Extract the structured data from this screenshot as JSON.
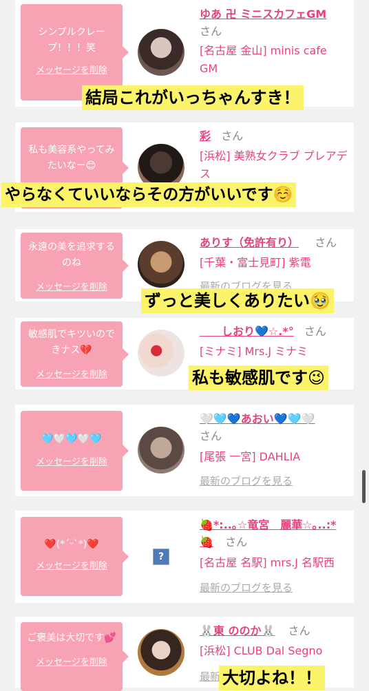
{
  "delete_label": "メッセージを削除",
  "blog_label": "最新のブログを見る",
  "san": "さん",
  "cards": [
    {
      "message": "シンプルクレープ！！！笑",
      "name": "ゆあ 卍 ミニスカフェGM",
      "shop": "[名古屋 金山] minis cafe GM"
    },
    {
      "message": "私も美容系やってみたいなー😊",
      "name": "彩",
      "shop": "[浜松] 美熟女クラブ プレアデス"
    },
    {
      "message": "永遠の美を追求するのね",
      "name": "ありす（免許有り）",
      "shop": "[千葉・富士見町] 紫電"
    },
    {
      "message": "敏感肌でキツいのできナス💔",
      "name": "　　しおり💙☆.*°",
      "shop": "[ミナミ] Mrs.J ミナミ"
    },
    {
      "message": "🩵🤍🩵🤍🩵",
      "name": "🤍🩵💙あおい💙🩵🤍",
      "shop": "[尾張 一宮] DAHLIA"
    },
    {
      "message": "❤️(*´ᵕ`*)❤️",
      "name": "🍓*:..｡☆竜宮　麗華☆｡..:*🍓",
      "shop": "[名古屋 名駅] mrs.J 名駅西"
    },
    {
      "message": "ご褒美は大切です💕",
      "name": "🐰東 ののか🐰",
      "shop": "[浜松] CLUB Dal Segno"
    }
  ],
  "captions": [
    "結局これがいっちゃんすき！",
    "やらなくていいならその方がいいです☺️",
    "ずっと美しくありたい🥹",
    "私も敏感肌です😉",
    "大切よね！！"
  ],
  "broken_image_glyph": "?"
}
